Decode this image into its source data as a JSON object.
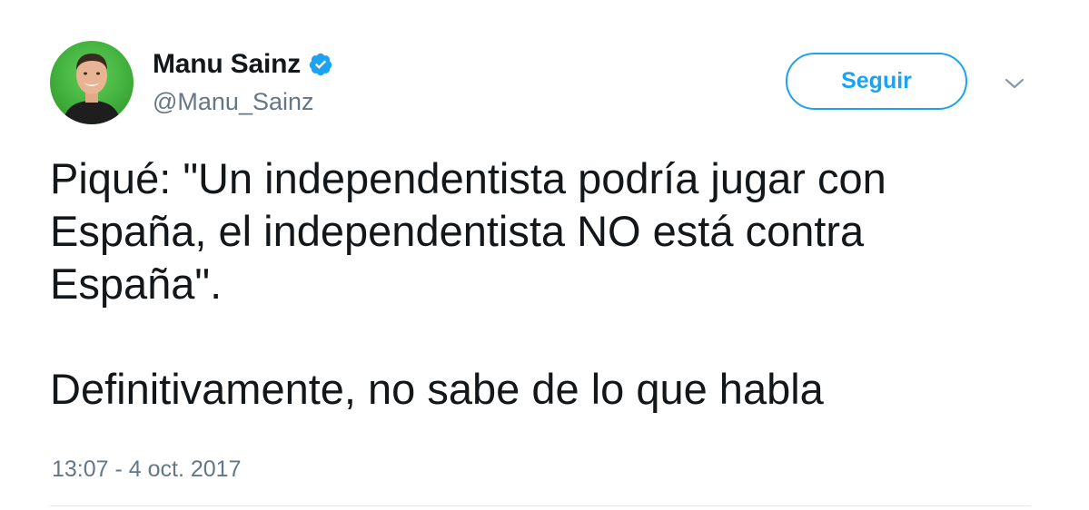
{
  "author": {
    "display_name": "Manu Sainz",
    "handle": "@Manu_Sainz",
    "verified_icon": "verified-badge-icon",
    "avatar_icon": "avatar-photo"
  },
  "actions": {
    "follow_label": "Seguir",
    "menu_icon": "chevron-down-icon"
  },
  "tweet": {
    "lines": [
      "Piqué: \"Un independentista podría jugar con",
      "España, el independentista NO está contra",
      "España\".",
      "",
      "Definitivamente, no sabe de lo que habla"
    ],
    "timestamp": "13:07 - 4 oct. 2017"
  },
  "colors": {
    "accent": "#1da1f2",
    "text_primary": "#14171a",
    "text_secondary": "#657786",
    "divider": "#e1e8ed"
  }
}
